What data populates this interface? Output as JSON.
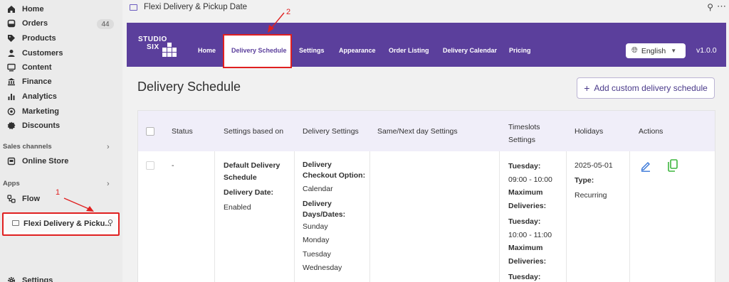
{
  "sidebar": {
    "items": [
      {
        "label": "Home",
        "icon": "home-icon"
      },
      {
        "label": "Orders",
        "icon": "orders-icon",
        "badge": "44"
      },
      {
        "label": "Products",
        "icon": "tag-icon"
      },
      {
        "label": "Customers",
        "icon": "person-icon"
      },
      {
        "label": "Content",
        "icon": "content-icon"
      },
      {
        "label": "Finance",
        "icon": "bank-icon"
      },
      {
        "label": "Analytics",
        "icon": "bar-chart-icon"
      },
      {
        "label": "Marketing",
        "icon": "target-icon"
      },
      {
        "label": "Discounts",
        "icon": "discount-icon"
      }
    ],
    "sales_channels_label": "Sales channels",
    "online_store": "Online Store",
    "apps_label": "Apps",
    "flow": "Flow",
    "active_app": "Flexi Delivery & Picku...",
    "settings": "Settings"
  },
  "annotations": {
    "one": "1",
    "two": "2",
    "color": "#e02020"
  },
  "titlebar": {
    "title": "Flexi Delivery & Pickup Date"
  },
  "app_header": {
    "logo_line1": "STUDIO",
    "logo_line2": "SIX",
    "nav": [
      "Home",
      "Delivery Schedule",
      "Settings",
      "Appearance",
      "Order Listing",
      "Delivery Calendar",
      "Pricing"
    ],
    "language": "English",
    "version": "v1.0.0",
    "brand_color": "#5b3f9c"
  },
  "page": {
    "title": "Delivery Schedule",
    "add_button": "Add custom delivery schedule"
  },
  "table": {
    "headers": {
      "status": "Status",
      "based_on": "Settings based on",
      "delivery": "Delivery Settings",
      "same_next": "Same/Next day Settings",
      "timeslots_1": "Timeslots",
      "timeslots_2": "Settings",
      "holidays": "Holidays",
      "actions": "Actions"
    },
    "row": {
      "status": "-",
      "based_on_1": "Default Delivery",
      "based_on_2": "Schedule",
      "delivery_date_label": "Delivery Date:",
      "delivery_date_value": "Enabled",
      "checkout_1": "Delivery",
      "checkout_2": "Checkout Option:",
      "checkout_value": "Calendar",
      "days_1": "Delivery",
      "days_2": "Days/Dates:",
      "days": [
        "Sunday",
        "Monday",
        "Tuesday",
        "Wednesday"
      ],
      "slot1_day": "Tuesday:",
      "slot1_time": "09:00 - 10:00",
      "max1_a": "Maximum",
      "max1_b": "Deliveries:",
      "slot2_day": "Tuesday:",
      "slot2_time": "10:00 - 11:00",
      "max2_a": "Maximum",
      "max2_b": "Deliveries:",
      "slot3_day": "Tuesday:",
      "holiday_date": "2025-05-01",
      "holiday_type_label": "Type:",
      "holiday_type_value": "Recurring"
    }
  }
}
